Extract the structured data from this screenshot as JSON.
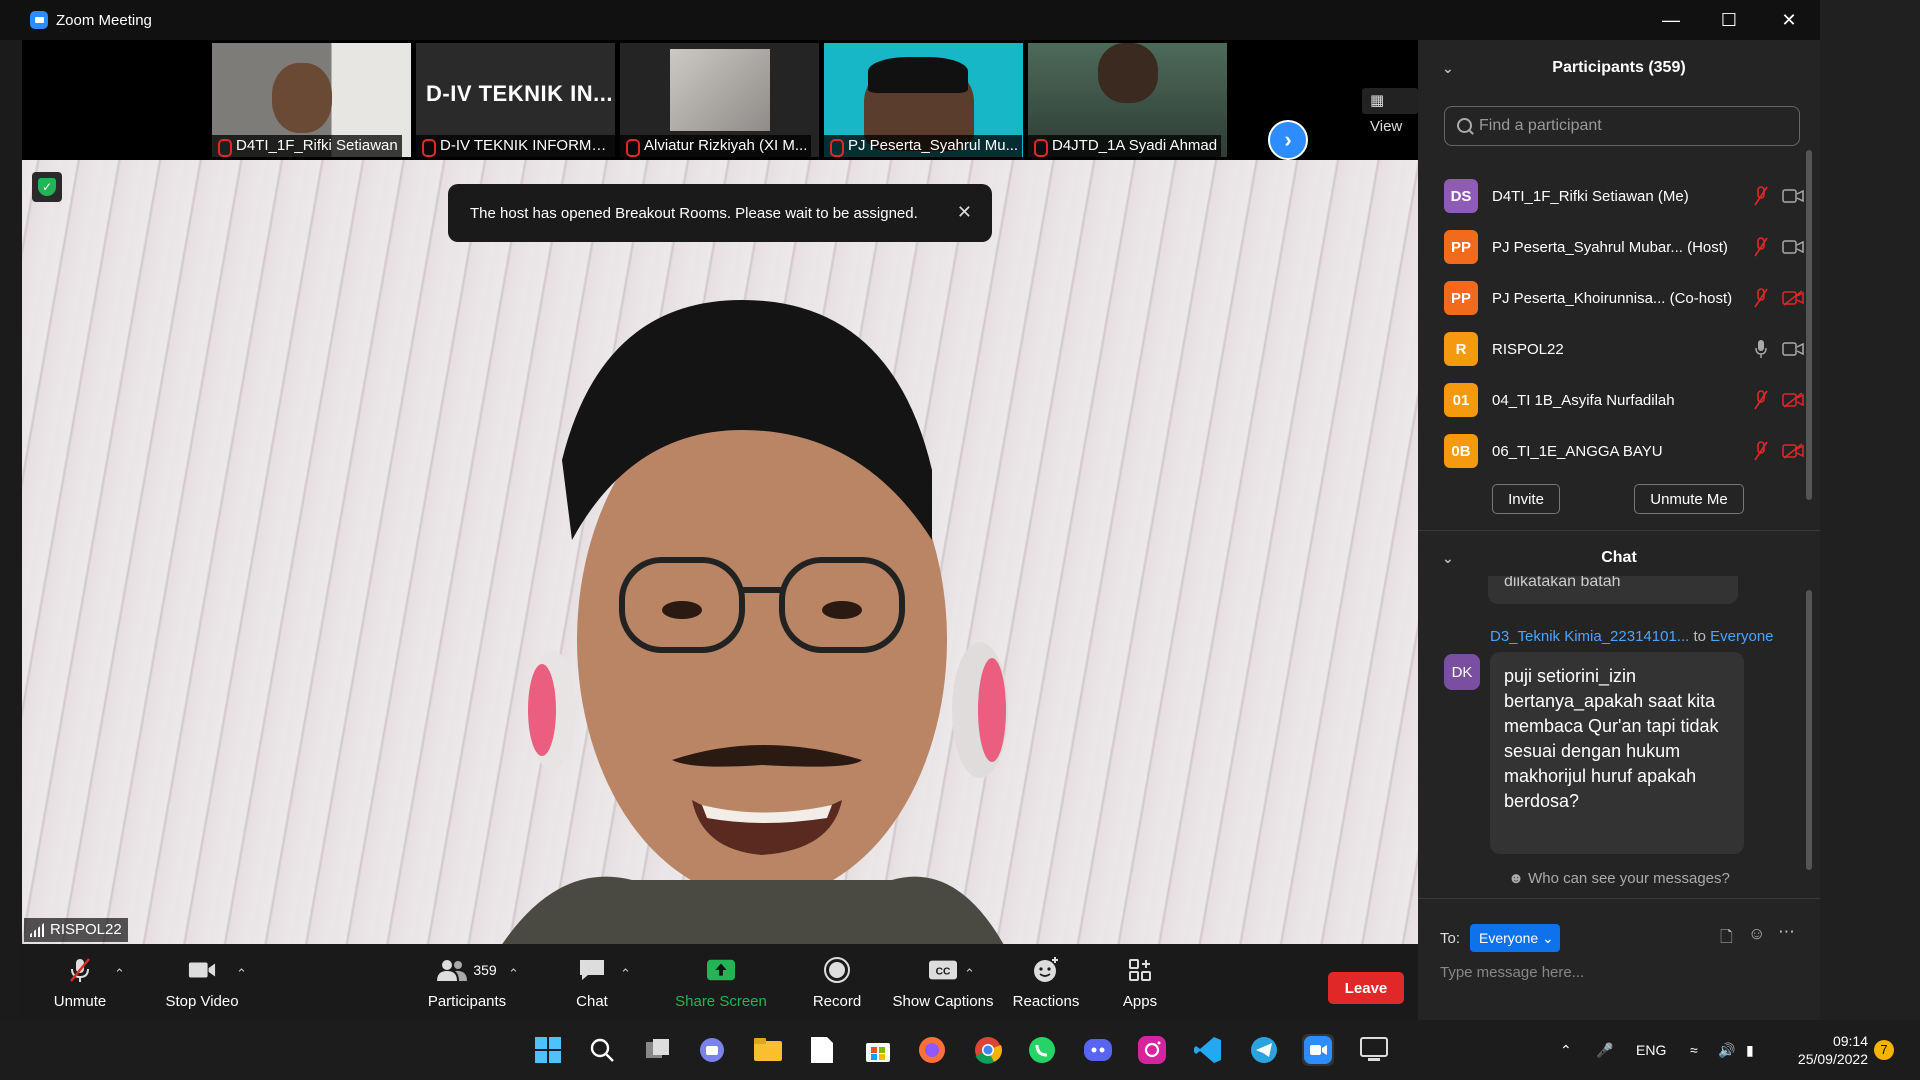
{
  "window": {
    "title": "Zoom Meeting"
  },
  "strip": {
    "thumbs": [
      {
        "name": "D4TI_1F_Rifki Setiawan"
      },
      {
        "name": "D-IV TEKNIK INFORMA...",
        "big": "D-IV TEKNIK IN..."
      },
      {
        "name": "Alviatur Rizkiyah (XI M..."
      },
      {
        "name": "PJ Peserta_Syahrul Mu..."
      },
      {
        "name": "D4JTD_1A Syadi Ahmad"
      }
    ],
    "view_label": "View"
  },
  "video": {
    "notification": "The host has opened Breakout Rooms. Please wait to be assigned.",
    "speaker_name": "RISPOL22"
  },
  "toolbar": {
    "unmute": "Unmute",
    "stop_video": "Stop Video",
    "participants": "Participants",
    "participants_count": "359",
    "chat": "Chat",
    "share_screen": "Share Screen",
    "record": "Record",
    "show_captions": "Show Captions",
    "reactions": "Reactions",
    "apps": "Apps",
    "leave": "Leave"
  },
  "participants_panel": {
    "title": "Participants (359)",
    "search_placeholder": "Find a participant",
    "items": [
      {
        "initials": "DS",
        "name": "D4TI_1F_Rifki Setiawan (Me)",
        "color": "#8e5cb5"
      },
      {
        "initials": "PP",
        "name": "PJ Peserta_Syahrul Mubar...  (Host)",
        "color": "#f26b1d"
      },
      {
        "initials": "PP",
        "name": "PJ Peserta_Khoirunnisa...  (Co-host)",
        "color": "#f26b1d"
      },
      {
        "initials": "R",
        "name": "RISPOL22",
        "color": "#f59a0c"
      },
      {
        "initials": "01",
        "name": "04_TI 1B_Asyifa Nurfadilah",
        "color": "#f59a0c"
      },
      {
        "initials": "0B",
        "name": "06_TI_1E_ANGGA BAYU",
        "color": "#f59a0c"
      }
    ],
    "invite": "Invite",
    "unmute_me": "Unmute Me"
  },
  "chat_panel": {
    "title": "Chat",
    "prev_fragment": "diikatakan batah",
    "sender": "D3_Teknik Kimia_22314101...",
    "to_word": "to",
    "to_target": "Everyone",
    "sender_initials": "DK",
    "message": "puji setiorini_izin bertanya_apakah saat kita membaca Qur'an tapi tidak sesuai dengan hukum makhorijul huruf apakah berdosa?",
    "who_can_see": "Who can see your messages?",
    "to_label": "To:",
    "recipient": "Everyone",
    "placeholder": "Type message here..."
  },
  "taskbar": {
    "lang": "ENG",
    "time": "09:14",
    "date": "25/09/2022",
    "notif_count": "7"
  },
  "colors": {
    "accent": "#2d8cff",
    "leave": "#e02828",
    "share": "#22b455"
  }
}
